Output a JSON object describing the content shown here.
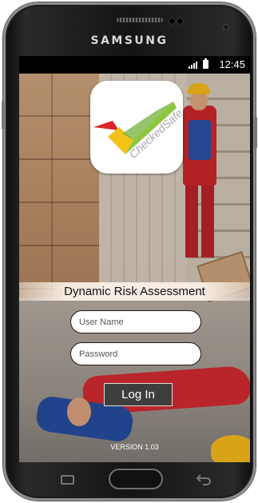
{
  "device": {
    "brand": "SAMSUNG"
  },
  "statusbar": {
    "time": "12:45",
    "signal_icon": "signal-icon",
    "battery_icon": "battery-icon"
  },
  "app": {
    "logo_text": "CheckedSafe",
    "logo_colors": {
      "red": "#d9262a",
      "yellow": "#f3c21a",
      "green": "#8dc63f"
    },
    "title": "Dynamic Risk Assessment",
    "username": {
      "value": "",
      "placeholder": "User Name"
    },
    "password": {
      "value": "",
      "placeholder": "Password"
    },
    "login_label": "Log In",
    "version": "VERSION 1.03"
  },
  "navbar": {
    "recent_icon": "recent-apps-icon",
    "home_icon": "home-button",
    "back_icon": "back-icon"
  }
}
